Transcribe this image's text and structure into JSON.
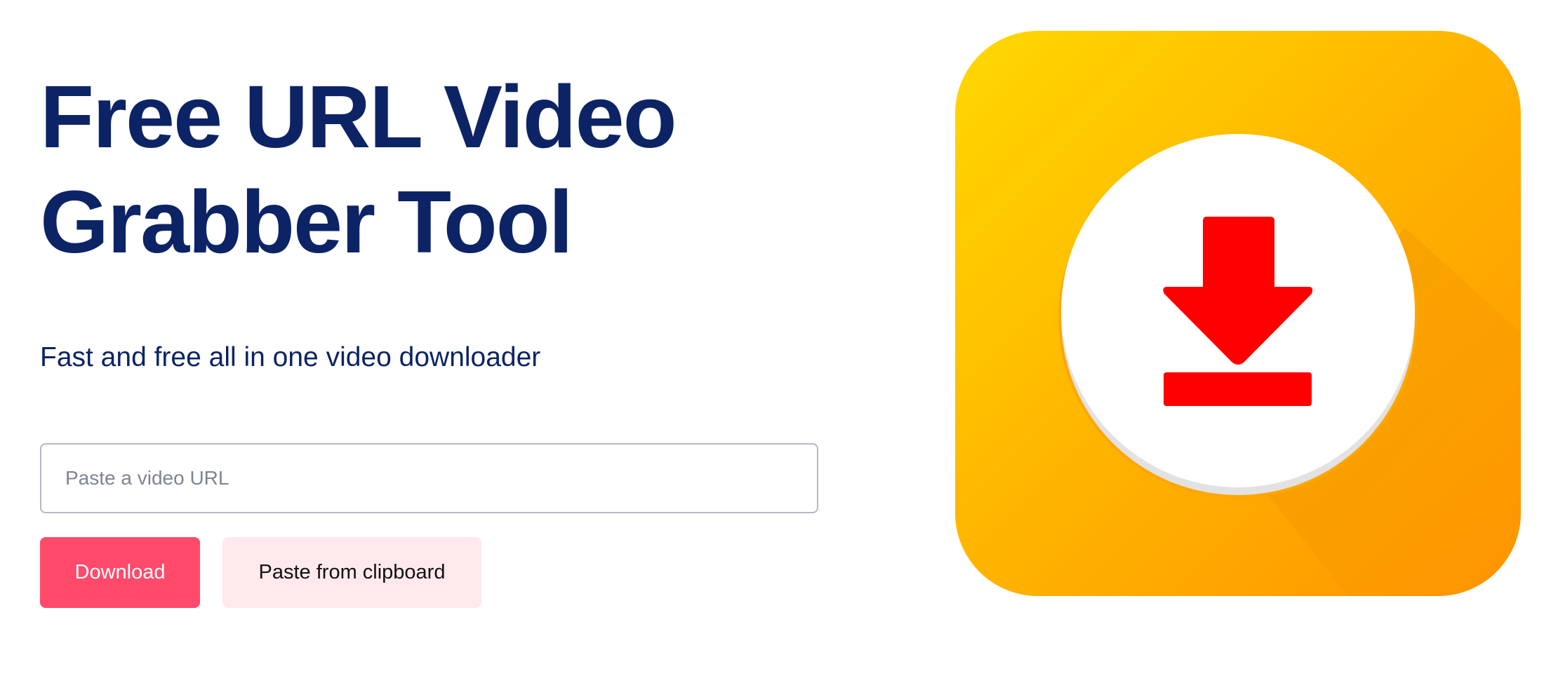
{
  "hero": {
    "title": "Free URL Video Grabber Tool",
    "subtitle": "Fast and free all in one video downloader"
  },
  "form": {
    "url_placeholder": "Paste a video URL",
    "url_value": "",
    "download_label": "Download",
    "paste_label": "Paste from clipboard"
  },
  "icon": {
    "name": "download-arrow-icon",
    "colors": {
      "background_top": "#ffd800",
      "background_bottom": "#ff9400",
      "arrow": "#ff0000",
      "circle": "#ffffff"
    }
  }
}
